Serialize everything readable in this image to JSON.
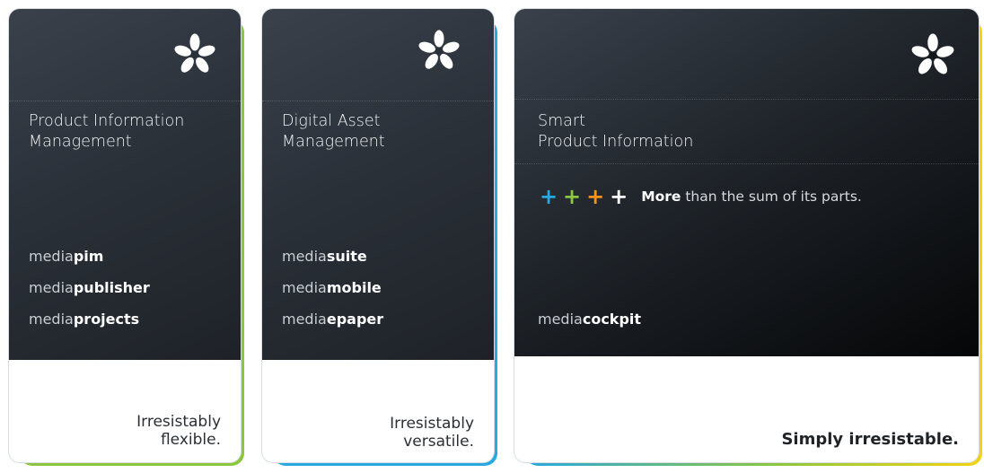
{
  "cards": [
    {
      "title_line1": "Product Information",
      "title_line2": "Management",
      "products": [
        {
          "prefix": "media",
          "suffix": "pim"
        },
        {
          "prefix": "media",
          "suffix": "publisher"
        },
        {
          "prefix": "media",
          "suffix": "projects"
        }
      ],
      "slogan_line1": "Irresistably",
      "slogan_line2": "flexible.",
      "accent_color": "#8cc63f"
    },
    {
      "title_line1": "Digital Asset",
      "title_line2": "Management",
      "products": [
        {
          "prefix": "media",
          "suffix": "suite"
        },
        {
          "prefix": "media",
          "suffix": "mobile"
        },
        {
          "prefix": "media",
          "suffix": "epaper"
        }
      ],
      "slogan_line1": "Irresistably",
      "slogan_line2": "versatile.",
      "accent_color": "#29a8e0"
    },
    {
      "title_line1": "Smart",
      "title_line2": "Product Information",
      "tagline_bold": "More",
      "tagline_rest": " than the sum of its parts.",
      "plus_colors": [
        "#29a8e0",
        "#8cc63f",
        "#f7941d",
        "#ffffff"
      ],
      "products": [
        {
          "prefix": "media",
          "suffix": "cockpit"
        }
      ],
      "slogan": "Simply irresistable.",
      "accent_colors": [
        "#29a8e0",
        "#8cc63f",
        "#f2d40f"
      ]
    }
  ],
  "icons": {
    "logo": "flower-logo-icon",
    "plus": "plus-icon"
  }
}
